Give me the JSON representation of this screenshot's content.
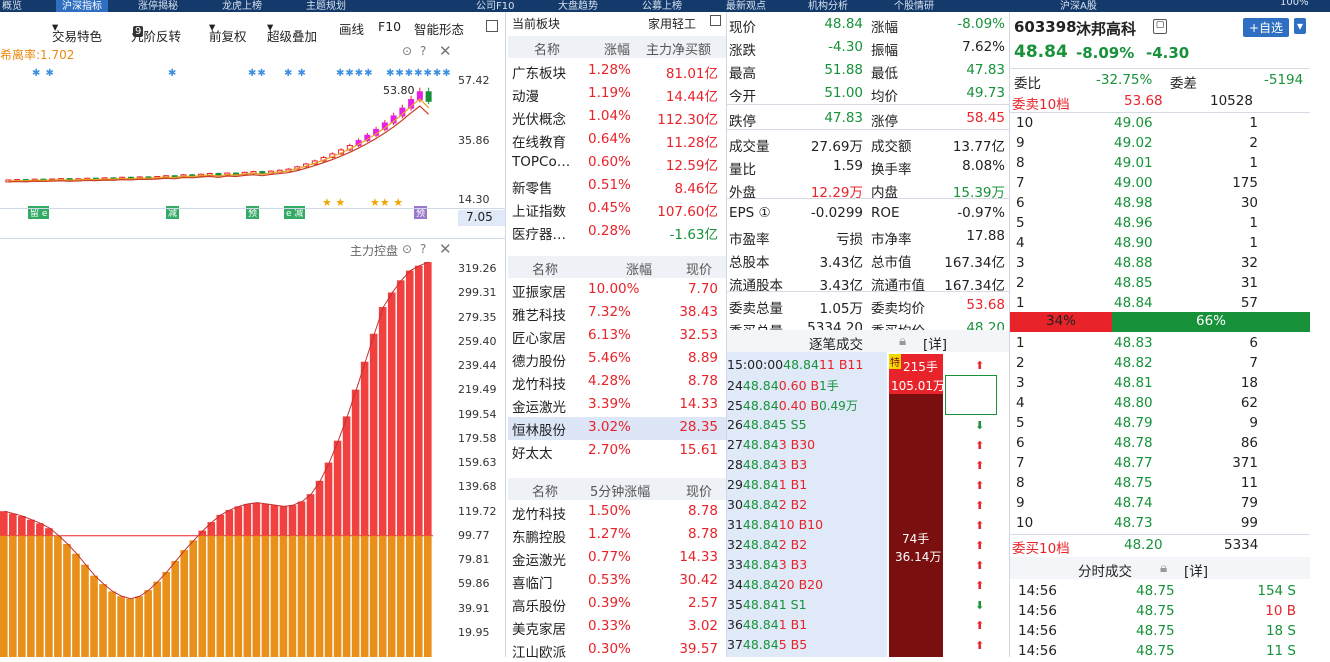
{
  "topbar": {
    "active": "沪深指标",
    "items": [
      "概览",
      "涨停揭秘",
      "龙虎上榜",
      "主题规划",
      "公司F10",
      "大盘趋势",
      "公募上榜",
      "最新观点",
      "机构分析",
      "个股情研",
      "沪深A股"
    ],
    "zoom": "100%"
  },
  "toolbar": {
    "items": [
      "交易特色",
      "九阶反转",
      "前复权",
      "超级叠加",
      "画线",
      "F10",
      "智能形态"
    ],
    "badge": "9"
  },
  "chart": {
    "indicator_label": "希离率:1.702",
    "price_axis": [
      "57.42",
      "35.86",
      "14.30"
    ],
    "last_price_tag": "7.05",
    "high_label": "53.80",
    "lower_title": "主力控盘",
    "lower_axis": [
      "319.26",
      "299.31",
      "279.35",
      "259.40",
      "239.44",
      "219.49",
      "199.54",
      "179.58",
      "159.63",
      "139.68",
      "119.72",
      "99.77",
      "79.81",
      "59.86",
      "39.91",
      "19.95"
    ],
    "candles": [
      7.4,
      7.6,
      7.5,
      7.8,
      7.7,
      7.9,
      8.1,
      7.8,
      8.0,
      8.3,
      8.2,
      8.5,
      8.4,
      8.8,
      8.6,
      9.0,
      8.9,
      9.2,
      9.6,
      9.3,
      10.1,
      9.9,
      10.4,
      10.8,
      10.2,
      11.0,
      10.7,
      11.4,
      11.8,
      11.2,
      12.0,
      12.5,
      13.1,
      14.3,
      15.8,
      17.4,
      19.2,
      21.1,
      23.2,
      25.5,
      28.1,
      30.9,
      34.0,
      37.4,
      41.1,
      45.2,
      49.7,
      53.8,
      48.8
    ],
    "bars": [
      120,
      118,
      116,
      113,
      110,
      106,
      100,
      93,
      85,
      76,
      67,
      60,
      54,
      50,
      48,
      50,
      55,
      62,
      70,
      79,
      88,
      96,
      104,
      111,
      117,
      121,
      124,
      126,
      127,
      126,
      125,
      124,
      125,
      128,
      134,
      145,
      160,
      178,
      198,
      220,
      243,
      266,
      288,
      300,
      310,
      318,
      322,
      325
    ]
  },
  "sector": {
    "current_label": "当前板块",
    "current_value": "家用轻工",
    "hdr1": [
      "名称",
      "涨幅",
      "主力净买额"
    ],
    "rows1": [
      [
        "广东板块",
        "1.28%",
        "81.01亿",
        "r"
      ],
      [
        "动漫",
        "1.19%",
        "14.44亿",
        "r"
      ],
      [
        "光伏概念",
        "1.04%",
        "112.30亿",
        "r"
      ],
      [
        "在线教育",
        "0.64%",
        "11.28亿",
        "r"
      ],
      [
        "TOPCo…",
        "0.60%",
        "12.59亿",
        "r"
      ],
      [
        "新零售",
        "0.51%",
        "8.46亿",
        "r"
      ],
      [
        "上证指数",
        "0.45%",
        "107.60亿",
        "r"
      ],
      [
        "医疗器…",
        "0.28%",
        "-1.63亿",
        "g"
      ]
    ],
    "hdr2": [
      "名称",
      "涨幅",
      "现价"
    ],
    "rows2": [
      [
        "亚振家居",
        "10.00%",
        "7.70"
      ],
      [
        "雅艺科技",
        "7.32%",
        "38.43"
      ],
      [
        "匠心家居",
        "6.13%",
        "32.53"
      ],
      [
        "德力股份",
        "5.46%",
        "8.89"
      ],
      [
        "龙竹科技",
        "4.28%",
        "8.78"
      ],
      [
        "金运激光",
        "3.39%",
        "14.33"
      ],
      [
        "恒林股份",
        "3.02%",
        "28.35"
      ],
      [
        "好太太",
        "2.70%",
        "15.61"
      ]
    ],
    "hdr3": [
      "名称",
      "5分钟涨幅",
      "现价"
    ],
    "rows3": [
      [
        "龙竹科技",
        "1.50%",
        "8.78"
      ],
      [
        "东鹏控股",
        "1.27%",
        "8.78"
      ],
      [
        "金运激光",
        "0.77%",
        "14.33"
      ],
      [
        "喜临门",
        "0.53%",
        "30.42"
      ],
      [
        "高乐股份",
        "0.39%",
        "2.57"
      ],
      [
        "美克家居",
        "0.33%",
        "3.02"
      ],
      [
        "江山欧派",
        "0.30%",
        "39.57"
      ]
    ]
  },
  "quote": {
    "rows": [
      [
        "现价",
        "48.84",
        "g",
        "涨幅",
        "-8.09%",
        "g"
      ],
      [
        "涨跌",
        "-4.30",
        "g",
        "振幅",
        "7.62%",
        "k"
      ],
      [
        "最高",
        "51.88",
        "g",
        "最低",
        "47.83",
        "g"
      ],
      [
        "今开",
        "51.00",
        "g",
        "均价",
        "49.73",
        "g"
      ],
      [
        "跌停",
        "47.83",
        "g",
        "涨停",
        "58.45",
        "r"
      ],
      [
        "成交量",
        "27.69万",
        "k",
        "成交额",
        "13.77亿",
        "k"
      ],
      [
        "量比",
        "1.59",
        "k",
        "换手率",
        "8.08%",
        "k"
      ],
      [
        "外盘",
        "12.29万",
        "r",
        "内盘",
        "15.39万",
        "g"
      ],
      [
        "EPS ①",
        "-0.0299",
        "k",
        "ROE",
        "-0.97%",
        "k"
      ],
      [
        "市盈率",
        "亏损",
        "k",
        "市净率",
        "17.88",
        "k"
      ],
      [
        "总股本",
        "3.43亿",
        "k",
        "总市值",
        "167.34亿",
        "k"
      ],
      [
        "流通股本",
        "3.43亿",
        "k",
        "流通市值",
        "167.34亿",
        "k"
      ],
      [
        "委卖总量",
        "1.05万",
        "k",
        "委卖均价",
        "53.68",
        "r"
      ],
      [
        "委买总量",
        "5334.20",
        "k",
        "委买均价",
        "48.20",
        "g"
      ]
    ],
    "tick_title": "逐笔成交",
    "tick_detail": "[详]",
    "ticks": [
      [
        "15:00:00",
        "48.84",
        "11 B",
        "11"
      ],
      [
        "24",
        "48.84",
        "0.60 B",
        "1手"
      ],
      [
        "25",
        "48.84",
        "0.40 B",
        "0.49万"
      ],
      [
        "26",
        "48.84",
        "5 S",
        "5"
      ],
      [
        "27",
        "48.84",
        "3 B",
        "30"
      ],
      [
        "28",
        "48.84",
        "3 B",
        "3"
      ],
      [
        "29",
        "48.84",
        "1 B",
        "1"
      ],
      [
        "30",
        "48.84",
        "2 B",
        "2"
      ],
      [
        "31",
        "48.84",
        "10 B",
        "10"
      ],
      [
        "32",
        "48.84",
        "2 B",
        "2"
      ],
      [
        "33",
        "48.84",
        "3 B",
        "3"
      ],
      [
        "34",
        "48.84",
        "20 B",
        "20"
      ],
      [
        "35",
        "48.84",
        "1 S",
        "1"
      ],
      [
        "36",
        "48.84",
        "1 B",
        "1"
      ],
      [
        "37",
        "48.84",
        "5 B",
        "5"
      ]
    ],
    "big_label1": "215手",
    "big_label2": "105.01万",
    "big_label3": "74手",
    "big_label4": "36.14万",
    "special": "特"
  },
  "orderbook": {
    "code": "603398",
    "name": "沐邦高科",
    "price": "48.84",
    "pct": "-8.09%",
    "chg": "-4.30",
    "add_btn": "+自选",
    "weibi_label": "委比",
    "weibi": "-32.75%",
    "weicha_label": "委差",
    "weicha": "-5194",
    "sell10_label": "委卖10档",
    "sell10_price": "53.68",
    "sell10_vol": "10528",
    "asks": [
      [
        "10",
        "49.06",
        "1"
      ],
      [
        "9",
        "49.02",
        "2"
      ],
      [
        "8",
        "49.01",
        "1"
      ],
      [
        "7",
        "49.00",
        "175"
      ],
      [
        "6",
        "48.98",
        "30"
      ],
      [
        "5",
        "48.96",
        "1"
      ],
      [
        "4",
        "48.90",
        "1"
      ],
      [
        "3",
        "48.88",
        "32"
      ],
      [
        "2",
        "48.85",
        "31"
      ],
      [
        "1",
        "48.84",
        "57"
      ]
    ],
    "ratio_sell": "34%",
    "ratio_buy": "66%",
    "ratio_value": 0.34,
    "bids": [
      [
        "1",
        "48.83",
        "6"
      ],
      [
        "2",
        "48.82",
        "7"
      ],
      [
        "3",
        "48.81",
        "18"
      ],
      [
        "4",
        "48.80",
        "62"
      ],
      [
        "5",
        "48.79",
        "9"
      ],
      [
        "6",
        "48.78",
        "86"
      ],
      [
        "7",
        "48.77",
        "371"
      ],
      [
        "8",
        "48.75",
        "11"
      ],
      [
        "9",
        "48.74",
        "79"
      ],
      [
        "10",
        "48.73",
        "99"
      ]
    ],
    "buy10_label": "委买10档",
    "buy10_price": "48.20",
    "buy10_vol": "5334",
    "fenshi_title": "分时成交",
    "fenshi_detail": "[详]",
    "fenshi": [
      [
        "14:56",
        "48.75",
        "154 S"
      ],
      [
        "14:56",
        "48.75",
        "10 B"
      ],
      [
        "14:56",
        "48.75",
        "18 S"
      ],
      [
        "14:56",
        "48.75",
        "11 S"
      ]
    ]
  }
}
